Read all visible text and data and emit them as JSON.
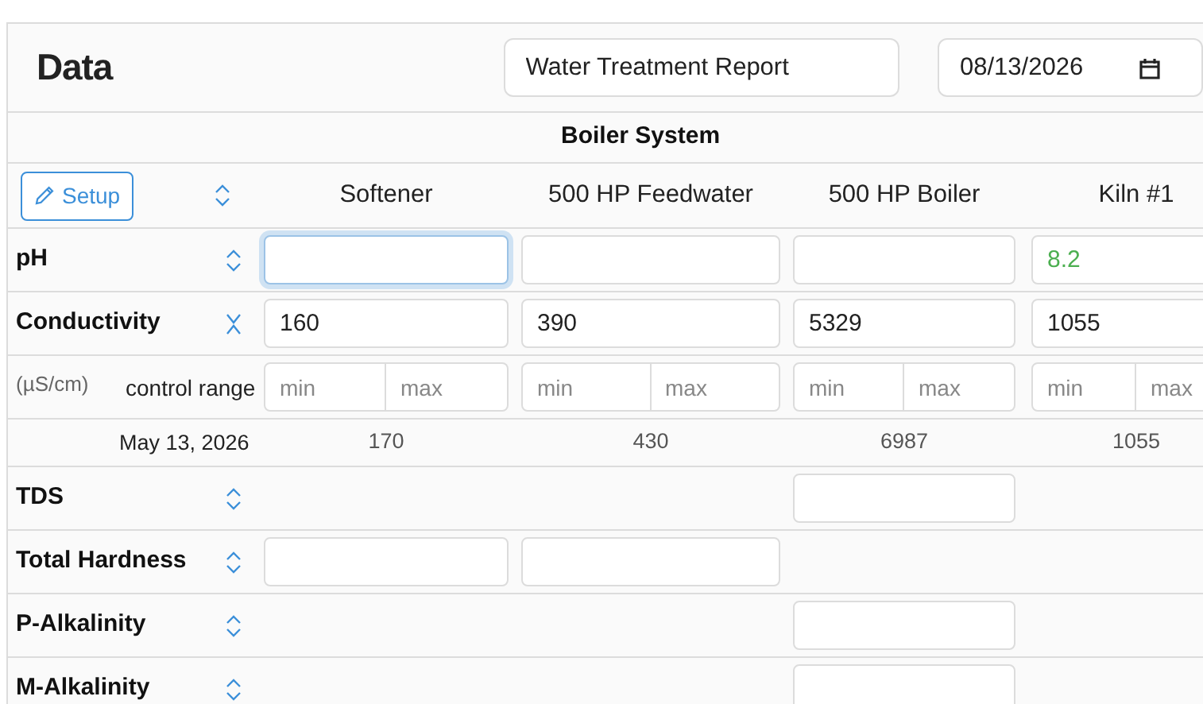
{
  "header": {
    "title": "Data",
    "report_name": "Water Treatment Report",
    "date": "08/13/2026"
  },
  "system": {
    "name": "Boiler System"
  },
  "setup_button": {
    "label": "Setup"
  },
  "columns": [
    "Softener",
    "500 HP Feedwater",
    "500 HP Boiler",
    "Kiln #1"
  ],
  "parameters": [
    {
      "name": "pH",
      "expanded": false,
      "cells": [
        {
          "kind": "field",
          "focused": true
        },
        {
          "kind": "field",
          "focused": false
        },
        {
          "kind": "field",
          "focused": false
        },
        {
          "kind": "field",
          "value": "8.2",
          "focused": false,
          "color": "#4caf50"
        }
      ]
    },
    {
      "name": "Conductivity",
      "expanded": true,
      "cells": [
        {
          "kind": "field",
          "value": "160",
          "focused": false
        },
        {
          "kind": "field",
          "value": "390",
          "focused": false
        },
        {
          "kind": "field",
          "value": "5329",
          "focused": false
        },
        {
          "kind": "field",
          "value": "1055",
          "focused": false
        }
      ],
      "unit": "(µS/cm)",
      "range_label": "control range",
      "range": [
        {
          "min_placeholder": "min",
          "max_placeholder": "max"
        },
        {
          "min_placeholder": "min",
          "max_placeholder": "max"
        },
        {
          "min_placeholder": "min",
          "max_placeholder": "max"
        },
        {
          "min_placeholder": "min",
          "max_placeholder": "max"
        }
      ],
      "last_date": "May 13, 2026",
      "last_values": [
        "170",
        "430",
        "6987",
        "1055"
      ]
    },
    {
      "name": "TDS",
      "expanded": false,
      "cells": [
        {
          "kind": "empty"
        },
        {
          "kind": "empty"
        },
        {
          "kind": "field",
          "focused": false
        },
        {
          "kind": "empty"
        }
      ]
    },
    {
      "name": "Total Hardness",
      "expanded": false,
      "cells": [
        {
          "kind": "field",
          "focused": false
        },
        {
          "kind": "field",
          "focused": false
        },
        {
          "kind": "empty"
        },
        {
          "kind": "empty"
        }
      ]
    },
    {
      "name": "P-Alkalinity",
      "expanded": false,
      "cells": [
        {
          "kind": "empty"
        },
        {
          "kind": "empty"
        },
        {
          "kind": "field",
          "focused": false
        },
        {
          "kind": "empty"
        }
      ]
    },
    {
      "name": "M-Alkalinity",
      "expanded": false,
      "cells": [
        {
          "kind": "empty"
        },
        {
          "kind": "empty"
        },
        {
          "kind": "field",
          "focused": false
        },
        {
          "kind": "empty"
        }
      ]
    }
  ]
}
